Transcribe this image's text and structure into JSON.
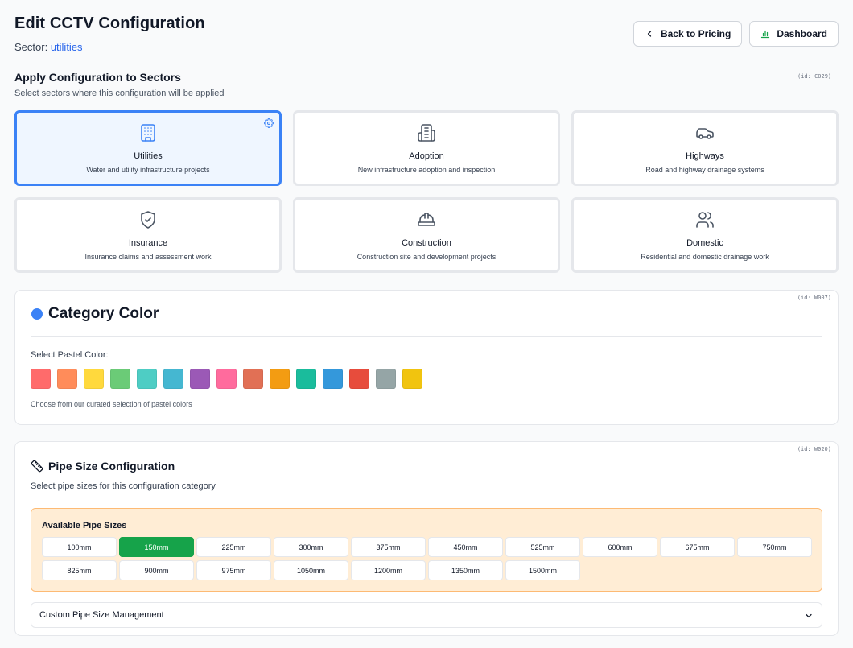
{
  "header": {
    "title": "Edit CCTV Configuration",
    "sector_label": "Sector:",
    "sector_value": "utilities",
    "back_button": "Back to Pricing",
    "dashboard_button": "Dashboard"
  },
  "apply_section": {
    "title": "Apply Configuration to Sectors",
    "subtitle": "Select sectors where this configuration will be applied",
    "id_tag": "(id: C029)"
  },
  "sectors": [
    {
      "name": "Utilities",
      "desc": "Water and utility infrastructure projects",
      "icon": "building-icon",
      "selected": true
    },
    {
      "name": "Adoption",
      "desc": "New infrastructure adoption and inspection",
      "icon": "buildings-icon",
      "selected": false
    },
    {
      "name": "Highways",
      "desc": "Road and highway drainage systems",
      "icon": "car-icon",
      "selected": false
    },
    {
      "name": "Insurance",
      "desc": "Insurance claims and assessment work",
      "icon": "shield-check-icon",
      "selected": false
    },
    {
      "name": "Construction",
      "desc": "Construction site and development projects",
      "icon": "hard-hat-icon",
      "selected": false
    },
    {
      "name": "Domestic",
      "desc": "Residential and domestic drainage work",
      "icon": "users-icon",
      "selected": false
    }
  ],
  "category_color": {
    "id_tag": "(id: W007)",
    "title": "Category Color",
    "selected_color": "#3b82f6",
    "label": "Select Pastel Color:",
    "help": "Choose from our curated selection of pastel colors",
    "swatches": [
      "#ff6b6b",
      "#ff8c5a",
      "#ffd93d",
      "#6bcb77",
      "#4ecdc4",
      "#45b7d1",
      "#9b59b6",
      "#ff6b9d",
      "#e17055",
      "#f39c12",
      "#1abc9c",
      "#3498db",
      "#e74c3c",
      "#95a5a6",
      "#f1c40f"
    ]
  },
  "pipe_config": {
    "id_tag": "(id: W020)",
    "title": "Pipe Size Configuration",
    "subtitle": "Select pipe sizes for this configuration category",
    "available_title": "Available Pipe Sizes",
    "selected_size": "150mm",
    "sizes": [
      "100mm",
      "150mm",
      "225mm",
      "300mm",
      "375mm",
      "450mm",
      "525mm",
      "600mm",
      "675mm",
      "750mm",
      "825mm",
      "900mm",
      "975mm",
      "1050mm",
      "1200mm",
      "1350mm",
      "1500mm"
    ],
    "custom_label": "Custom Pipe Size Management"
  }
}
